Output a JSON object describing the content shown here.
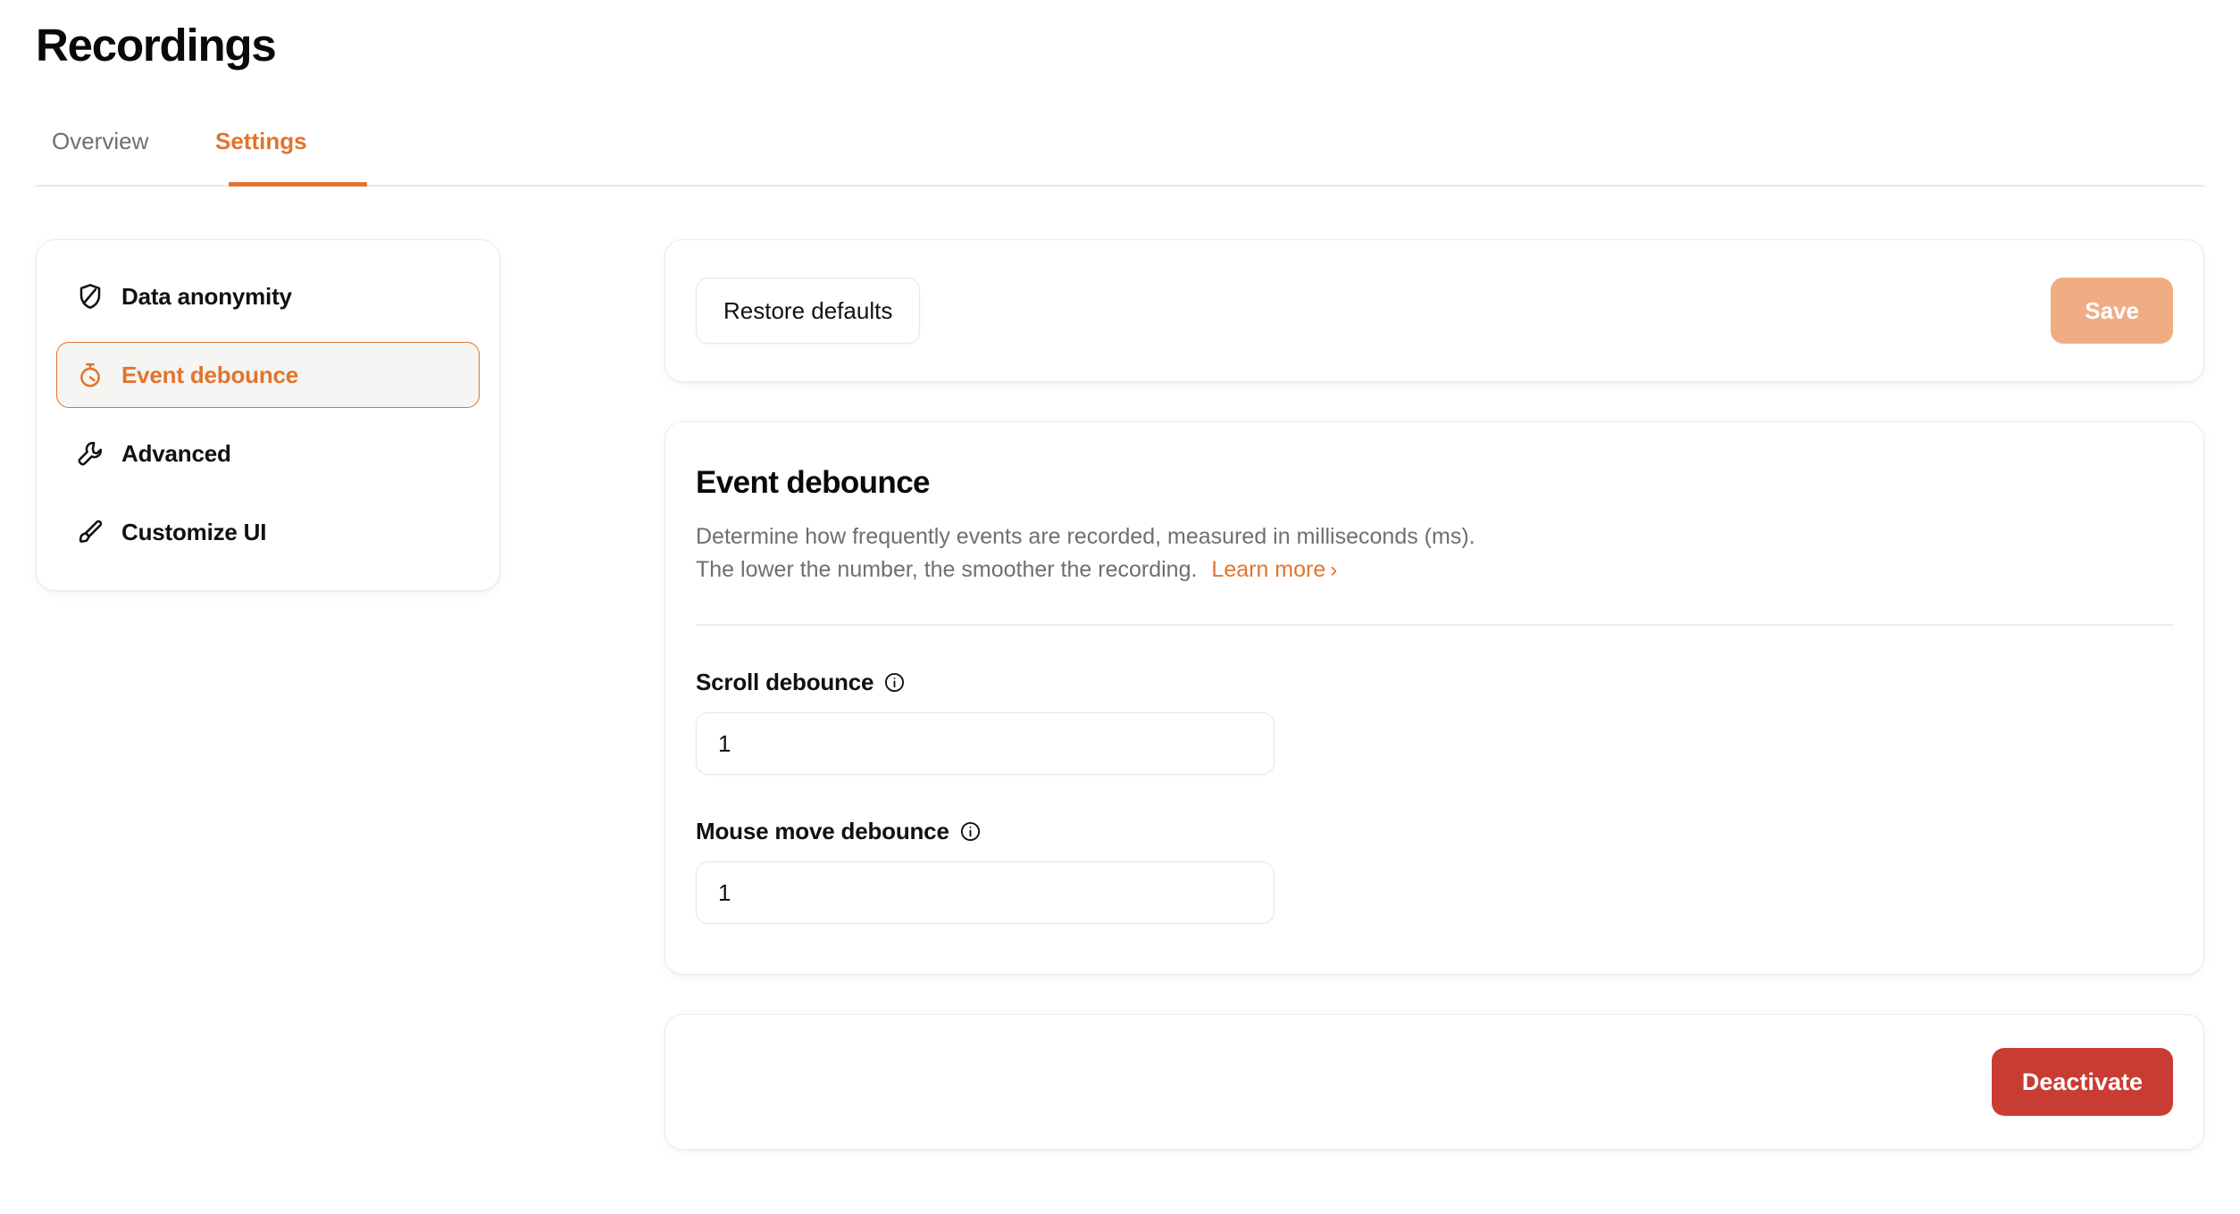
{
  "header": {
    "title": "Recordings"
  },
  "tabs": [
    {
      "label": "Overview",
      "active": false
    },
    {
      "label": "Settings",
      "active": true
    }
  ],
  "sidebar": {
    "items": [
      {
        "label": "Data anonymity",
        "icon": "shield-off-icon",
        "active": false
      },
      {
        "label": "Event debounce",
        "icon": "timer-icon",
        "active": true
      },
      {
        "label": "Advanced",
        "icon": "wrench-icon",
        "active": false
      },
      {
        "label": "Customize UI",
        "icon": "paintbrush-icon",
        "active": false
      }
    ]
  },
  "action_bar": {
    "restore_label": "Restore defaults",
    "save_label": "Save",
    "save_disabled": true
  },
  "debounce_card": {
    "title": "Event debounce",
    "description_line1": "Determine how frequently events are recorded, measured in milliseconds (ms).",
    "description_line2": "The lower the number, the smoother the recording.",
    "learn_more_label": "Learn more",
    "learn_more_chevron": "›",
    "fields": [
      {
        "label": "Scroll debounce",
        "value": "1",
        "placeholder": "1",
        "info_icon": "info-circle-icon"
      },
      {
        "label": "Mouse move debounce",
        "value": "1",
        "placeholder": "1",
        "info_icon": "info-circle-icon"
      }
    ]
  },
  "deactivate_card": {
    "deactivate_label": "Deactivate"
  },
  "colors": {
    "accent_orange": "#E2742E",
    "save_disabled_orange": "#F0AD83",
    "danger_red": "#C93C33",
    "muted_text": "#6F6F6D",
    "border": "#ECECEA",
    "active_nav_bg": "#F5F5F3"
  }
}
